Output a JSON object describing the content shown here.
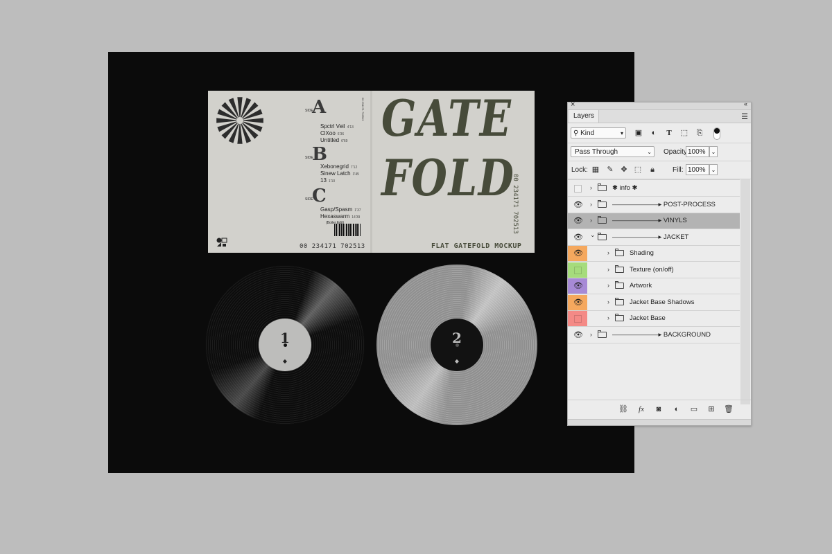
{
  "artwork": {
    "side_tag": "SIDE",
    "side_a": {
      "mark": "A",
      "tracks": [
        {
          "title": "Spctrl Veil",
          "dur": "4'13"
        },
        {
          "title": "ClXoo",
          "dur": "6'36"
        },
        {
          "title": "Untitled",
          "dur": "6'69"
        }
      ]
    },
    "side_b": {
      "mark": "B",
      "tracks": [
        {
          "title": "Xebonegrid",
          "dur": "7'12"
        },
        {
          "title": "Sinew Latch",
          "dur": "3'45"
        },
        {
          "title": "13",
          "dur": "1'10"
        }
      ]
    },
    "side_c": {
      "mark": "C",
      "tracks": [
        {
          "title": "Gasp/Spasm",
          "dur": "1'37"
        },
        {
          "title": "Hexaswarm",
          "dur": "14'39"
        }
      ],
      "note": "(Boiler Edit)"
    },
    "barcode_number": "00 234171 702513",
    "spine_text": "00 234171 702513",
    "title_lines": [
      "GATE",
      "FOLD"
    ],
    "vertical_code": "00 234171 702513",
    "subtitle": "FLAT GATEFOLD MOCKUP",
    "vinyl_1_label": "1",
    "vinyl_2_label": "2",
    "colors": {
      "ink": "#474b3a",
      "paper": "#d2d1cc",
      "canvas": "#0b0b0b",
      "background": "#bdbdbd"
    }
  },
  "panel": {
    "close_glyph": "×",
    "collapse_glyph": "«",
    "tab": "Layers",
    "filter_kind": "Kind",
    "blend_mode": "Pass Through",
    "opacity_label": "Opacity:",
    "opacity_value": "100%",
    "lock_label": "Lock:",
    "fill_label": "Fill:",
    "fill_value": "100%",
    "layers": [
      {
        "name": "✱ info ✱",
        "visible": false,
        "color": "",
        "indent": 0,
        "expanded": false,
        "selected": false
      },
      {
        "name": "———————▸ POST-PROCESS",
        "visible": true,
        "color": "",
        "indent": 0,
        "expanded": false,
        "selected": false
      },
      {
        "name": "———————▸ VINYLS",
        "visible": true,
        "color": "",
        "indent": 0,
        "expanded": false,
        "selected": true
      },
      {
        "name": "———————▸ JACKET",
        "visible": true,
        "color": "",
        "indent": 0,
        "expanded": true,
        "selected": false
      },
      {
        "name": "Shading",
        "visible": true,
        "color": "#f5a85e",
        "indent": 1,
        "expanded": false,
        "selected": false
      },
      {
        "name": "Texture (on/off)",
        "visible": false,
        "color": "#a6dc7c",
        "indent": 1,
        "expanded": false,
        "selected": false
      },
      {
        "name": "Artwork",
        "visible": true,
        "color": "#a78ad6",
        "indent": 1,
        "expanded": false,
        "selected": false
      },
      {
        "name": "Jacket Base Shadows",
        "visible": true,
        "color": "#f5a85e",
        "indent": 1,
        "expanded": false,
        "selected": false
      },
      {
        "name": "Jacket Base",
        "visible": false,
        "color": "#f48a86",
        "indent": 1,
        "expanded": false,
        "selected": false
      },
      {
        "name": "———————▸ BACKGROUND",
        "visible": true,
        "color": "",
        "indent": 0,
        "expanded": false,
        "selected": false
      }
    ]
  }
}
